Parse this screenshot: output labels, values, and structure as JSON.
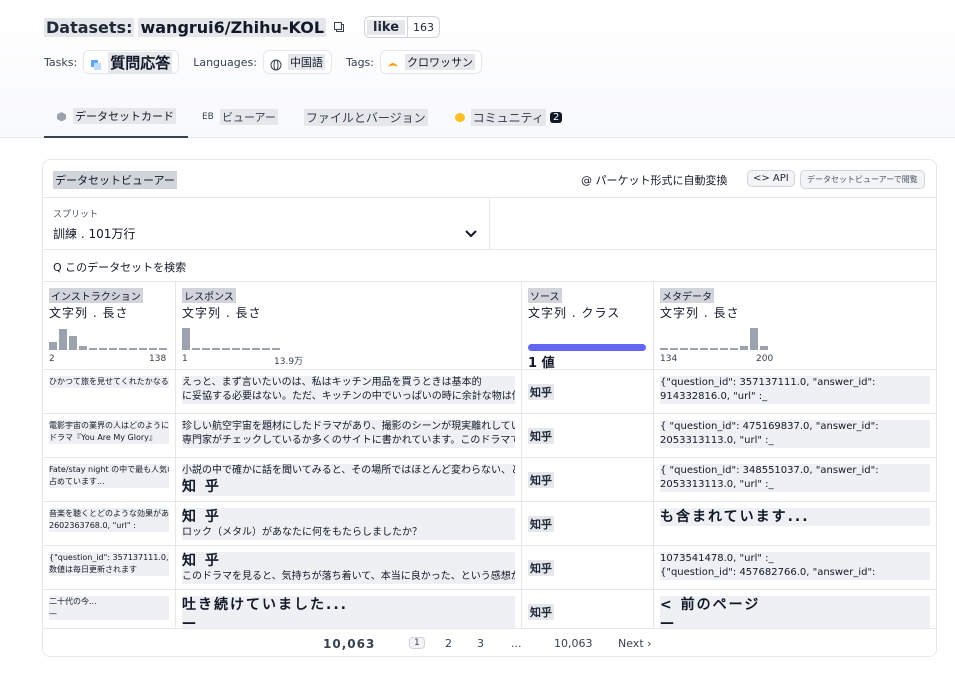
{
  "header": {
    "title_prefix": "Datasets:",
    "title_name": "wangrui6/Zhihu-KOL",
    "like_label": "like",
    "like_count": "163"
  },
  "meta": {
    "tasks_label": "Tasks:",
    "task_value": "質問応答",
    "languages_label": "Languages:",
    "language_value": "中国語",
    "tags_label": "Tags:",
    "tag_value": "クロワッサン"
  },
  "tabs": [
    {
      "label": "データセットカード"
    },
    {
      "label": "ビューアー"
    },
    {
      "label": "ファイルとバージョン"
    },
    {
      "label": "コミュニティ",
      "badge": "2"
    }
  ],
  "viewer": {
    "title": "データセットビューアー",
    "convert_label": "@ パーケット形式に自動変換",
    "api_label": "<> API",
    "fullview_label": "データセットビューアーで閲覧",
    "split_label": "スプリット",
    "split_value": "訓練 . 101万行",
    "search_placeholder": "Q このデータセットを検索"
  },
  "columns": [
    {
      "name": "インストラクション",
      "type": "文字列 . 長さ",
      "lo": "2",
      "hi": "138",
      "hist": [
        0.3,
        0.8,
        0.55,
        0.15,
        0.05,
        0.05,
        0.05,
        0.05,
        0.05,
        0.05,
        0.05,
        0.05
      ]
    },
    {
      "name": "レスポンス",
      "type": "文字列 . 長さ",
      "lo": "1",
      "hi": "13.9万",
      "hist": [
        0.85,
        0.05,
        0.05,
        0.05,
        0.05,
        0.05,
        0.05,
        0.05,
        0.05,
        0.05
      ]
    },
    {
      "name": "ソース",
      "type": "文字列 . クラス",
      "class_label": "1 値"
    },
    {
      "name": "メタデータ",
      "type": "文字列 . 長さ",
      "lo": "134",
      "hi": "200",
      "hist": [
        0.05,
        0.05,
        0.05,
        0.05,
        0.05,
        0.05,
        0.05,
        0.05,
        0.15,
        0.85,
        0.15
      ]
    }
  ],
  "rows": [
    {
      "c1": [
        "ひかつて旅を見せてくれたかなるか、どうなるのか"
      ],
      "c2": [
        "えっと、まず言いたいのは、私はキッチン用品を買うときは基本的",
        "に妥協する必要はない。ただ、キッチンの中でいっぱいの時に余計な物は使わない。"
      ],
      "c3": "知乎",
      "c4": [
        "{\"question_id\": 357137111.0, \"answer_id\":",
        "914332816.0, \"url\" :_"
      ]
    },
    {
      "c1": [
        "電影宇宙の業界の人はどのように言われていますか",
        "ドラマ『You Are My Glory』"
      ],
      "c2": [
        "珍しい航空宇宙を題材にしたドラマがあり、撮影のシーンが現実離れしていないか。",
        "専門家がチェックしているか多くのサイトに書かれています。このドラマでディテールが重要で、良い"
      ],
      "c3": "知乎",
      "c4": [
        "{ \"question_id\": 475169837.0, \"answer_id\":",
        "2053313113.0, \"url\" :_"
      ]
    },
    {
      "c1": [
        "Fate/stay night の中で最も人気のあることを教えてください",
        "占めています..."
      ],
      "c2": [
        "小説の中で確かに話を聞いてみると、その場所ではほとんど変わらない、と思います。",
        "知 乎"
      ],
      "c3": "知乎",
      "c4": [
        "{ \"question_id\": 348551037.0, \"answer_id\":",
        "2053313113.0, \"url\" :_"
      ]
    },
    {
      "c1": [
        "音楽を聴くとどのような効果がありますか",
        "2602363768.0, \"url\" :"
      ],
      "c2": [
        "知 乎",
        "ロック（メタル）があなたに何をもたらしましたか？"
      ],
      "c3": "知乎",
      "c4": [
        "も含まれています..."
      ]
    },
    {
      "c1": [
        "{\"question_id\": 357137111.0, \"answer_id\":",
        "数値は毎日更新されます"
      ],
      "c2": [
        "知 乎",
        "このドラマを見ると、気持ちが落ち着いて、本当に良かった、という感想が多いです。"
      ],
      "c3": "知乎",
      "c4": [
        "1073541478.0, \"url\" :_",
        "{\"question_id\": 457682766.0, \"answer_id\":"
      ]
    },
    {
      "c1": [
        "二十代の今...",
        "—"
      ],
      "c2": [
        "吐き続けていました...",
        "—"
      ],
      "c3": "知乎",
      "c4": [
        "< 前のページ",
        "—"
      ]
    }
  ],
  "pager": {
    "total_left": "10,063",
    "current": "1",
    "p2": "2",
    "p3": "3",
    "ellipsis": "...",
    "last": "10,063",
    "next": "Next ›"
  }
}
